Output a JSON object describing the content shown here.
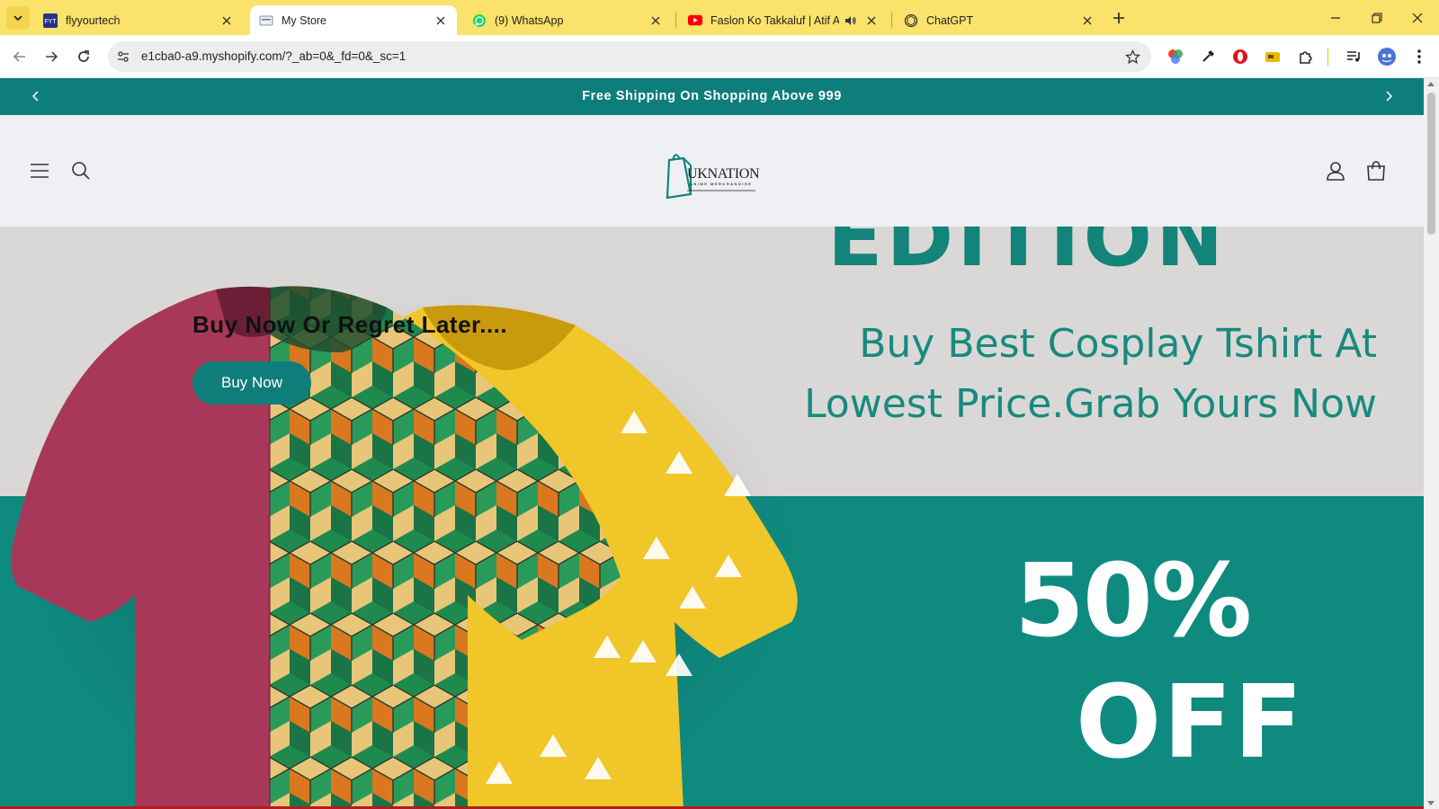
{
  "browser": {
    "tabs": [
      {
        "title": "flyyourtech",
        "favicon": "flyyourtech-favicon",
        "active": false
      },
      {
        "title": "My Store",
        "favicon": "shopify-store-favicon",
        "active": true
      },
      {
        "title": "(9) WhatsApp",
        "favicon": "whatsapp-icon",
        "active": false
      },
      {
        "title": "Faslon Ko Takkaluf | Atif Aslam",
        "favicon": "youtube-icon",
        "active": false,
        "playing_audio": true
      },
      {
        "title": "ChatGPT",
        "favicon": "chatgpt-icon",
        "active": false
      }
    ],
    "address": "e1cba0-a9.myshopify.com/?_ab=0&_fd=0&_sc=1",
    "colors": {
      "tabstrip": "#fbe26a",
      "omnibox": "#ededed"
    }
  },
  "store": {
    "announcement": "Free Shipping On Shopping Above 999",
    "logo": {
      "name": "UKNATION",
      "tagline": "ANIME MERCHANDISE"
    },
    "hero": {
      "top_banner_text": "EDITION",
      "heading": "Buy Now Or Regret Later....",
      "button_label": "Buy Now",
      "promo_line1": "Buy Best Cosplay Tshirt At",
      "promo_line2": "Lowest Price.Grab Yours Now",
      "discount_line1": "50%",
      "discount_line2": "OFF"
    },
    "colors": {
      "brand": "#0d7e7b",
      "hero_bottom": "#0f8a7f",
      "hero_top": "#dad8d6"
    }
  }
}
